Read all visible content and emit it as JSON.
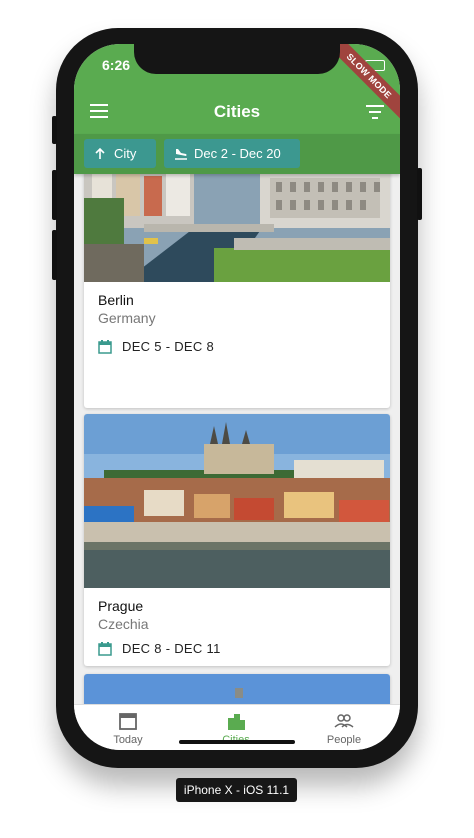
{
  "status_bar": {
    "time": "6:26"
  },
  "debug_banner": "SLOW MODE",
  "app_bar": {
    "title": "Cities"
  },
  "filter_chips": [
    {
      "icon": "arrow-up-icon",
      "label": "City"
    },
    {
      "icon": "flight-land-icon",
      "label": "Dec 2 - Dec 20"
    }
  ],
  "cards": [
    {
      "city": "Berlin",
      "country": "Germany",
      "dates": "DEC 5 - DEC 8",
      "image": "berlin-river-photo"
    },
    {
      "city": "Prague",
      "country": "Czechia",
      "dates": "DEC 8 - DEC 11",
      "image": "prague-castle-photo"
    },
    {
      "city": "",
      "country": "",
      "dates": "",
      "image": "city-dome-photo"
    }
  ],
  "bottom_nav": {
    "items": [
      {
        "label": "Today",
        "icon": "calendar-icon",
        "active": false
      },
      {
        "label": "Cities",
        "icon": "city-icon",
        "active": true
      },
      {
        "label": "People",
        "icon": "people-icon",
        "active": false
      }
    ]
  },
  "device_label": "iPhone X - iOS 11.1",
  "colors": {
    "primary": "#5aab50",
    "primary_dark": "#4f9947",
    "chip": "#3c9890",
    "accent_icon": "#3a9a8e",
    "active_nav": "#5aab50"
  }
}
